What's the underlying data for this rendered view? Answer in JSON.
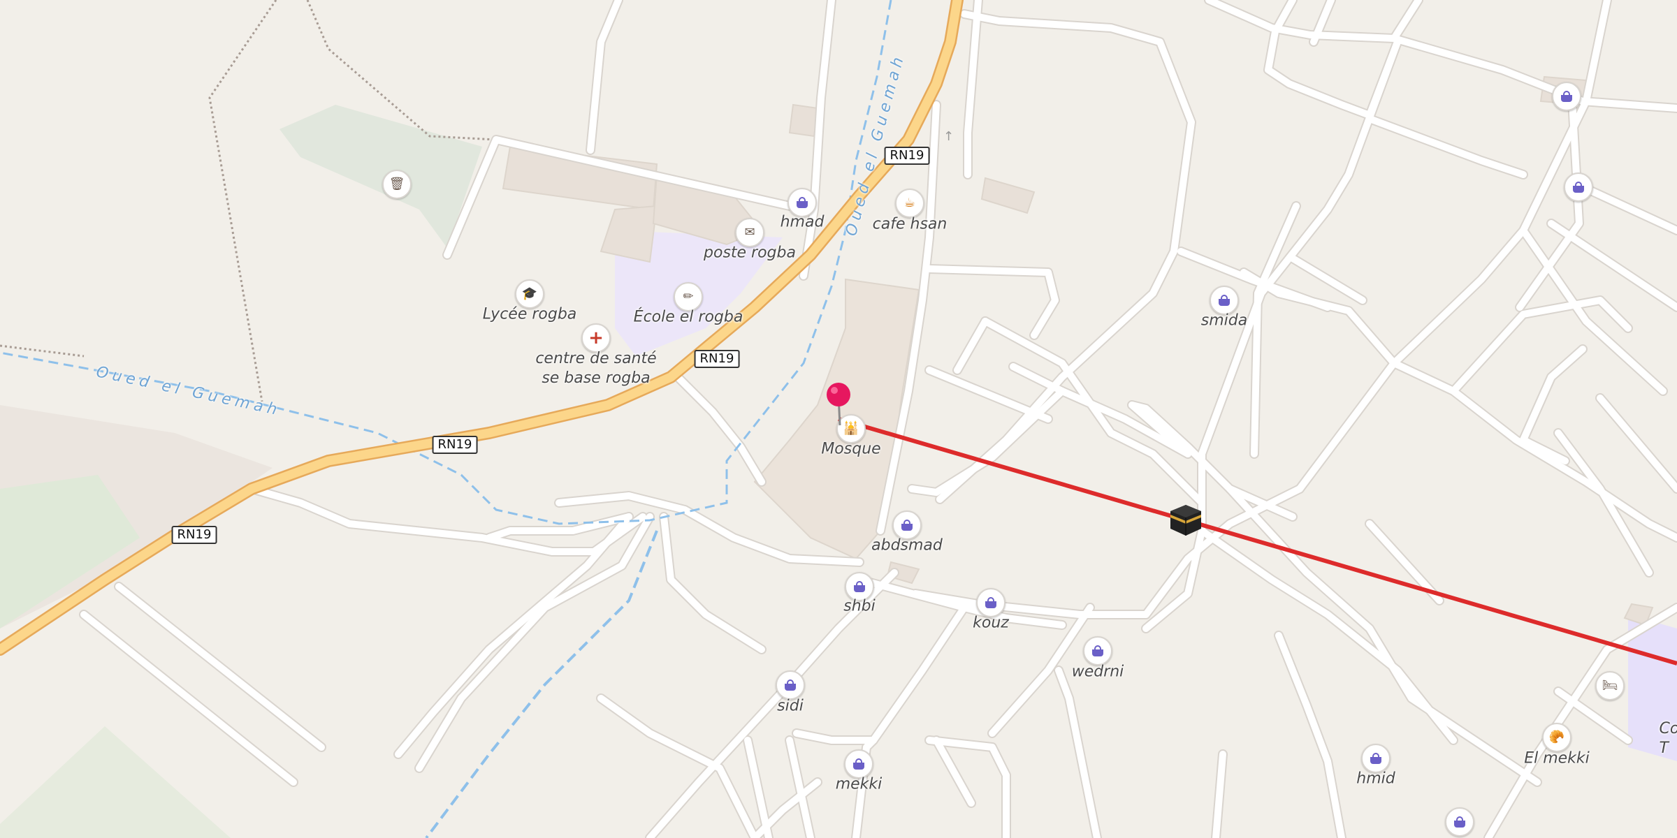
{
  "map": {
    "roads": [
      "RN19",
      "RN19",
      "RN19",
      "RN19"
    ],
    "water": [
      "Oued el Guemah",
      "Oued el Guemah"
    ],
    "places": [
      {
        "name": "hmad",
        "type": "shop",
        "icon": "basket-icon"
      },
      {
        "name": "cafe hsan",
        "type": "cafe",
        "icon": "cup-icon"
      },
      {
        "name": "poste rogba",
        "type": "post-office",
        "icon": "envelope-icon"
      },
      {
        "name": "Lycée rogba",
        "type": "school",
        "icon": "graduation-cap-icon"
      },
      {
        "name": "École el rogba",
        "type": "school",
        "icon": "ruler-pencil-icon"
      },
      {
        "name": "centre de santé\nse base rogba",
        "type": "health",
        "icon": "red-cross-icon"
      },
      {
        "name": "Mosque",
        "type": "mosque",
        "icon": "mosque-icon"
      },
      {
        "name": "abdsmad",
        "type": "shop",
        "icon": "basket-icon"
      },
      {
        "name": "shbi",
        "type": "shop",
        "icon": "basket-icon"
      },
      {
        "name": "kouz",
        "type": "shop",
        "icon": "basket-icon"
      },
      {
        "name": "wedrni",
        "type": "shop",
        "icon": "basket-icon"
      },
      {
        "name": "sidi",
        "type": "shop",
        "icon": "basket-icon"
      },
      {
        "name": "mekki",
        "type": "shop",
        "icon": "basket-icon"
      },
      {
        "name": "smida",
        "type": "shop",
        "icon": "basket-icon"
      },
      {
        "name": "hmid",
        "type": "shop",
        "icon": "basket-icon"
      },
      {
        "name": "El mekki",
        "type": "bakery",
        "icon": "croissant-icon"
      },
      {
        "name": "Col\nT",
        "type": "school",
        "icon": ""
      }
    ],
    "unlabeled_pois": [
      "waste-basket-icon",
      "basket-icon",
      "basket-icon",
      "bed-icon",
      "basket-icon"
    ],
    "colors": {
      "background": "#f2efe9",
      "road": "#ffffff",
      "primary_road": "#fcd68a",
      "qibla_line": "#dd2b2b",
      "pin": "#e6175f",
      "water": "#8ec0ea",
      "school_area": "#ece6f9",
      "green_area": "#dfe6dc"
    }
  }
}
